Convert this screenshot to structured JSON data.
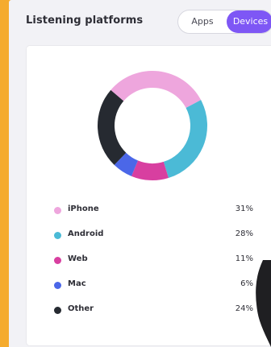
{
  "panel": {
    "title": "Listening platforms",
    "toggle": {
      "apps_label": "Apps",
      "devices_label": "Devices",
      "selected": "Devices"
    }
  },
  "chart_data": {
    "type": "pie",
    "categories": [
      "iPhone",
      "Android",
      "Web",
      "Mac",
      "Other"
    ],
    "values": [
      31,
      28,
      11,
      6,
      24
    ],
    "colors": [
      "#eea6dd",
      "#4bbad6",
      "#d83fa0",
      "#4b67e8",
      "#262a31"
    ]
  },
  "legend": [
    {
      "label": "iPhone",
      "pct": "31%",
      "color": "#eea6dd"
    },
    {
      "label": "Android",
      "pct": "28%",
      "color": "#4bbad6"
    },
    {
      "label": "Web",
      "pct": "11%",
      "color": "#d83fa0"
    },
    {
      "label": "Mac",
      "pct": "6%",
      "color": "#4b67e8"
    },
    {
      "label": "Other",
      "pct": "24%",
      "color": "#262a31"
    }
  ],
  "colors": {
    "background": "#f5ab2e",
    "panel": "#f2f2f6",
    "accent": "#7e57f5"
  }
}
